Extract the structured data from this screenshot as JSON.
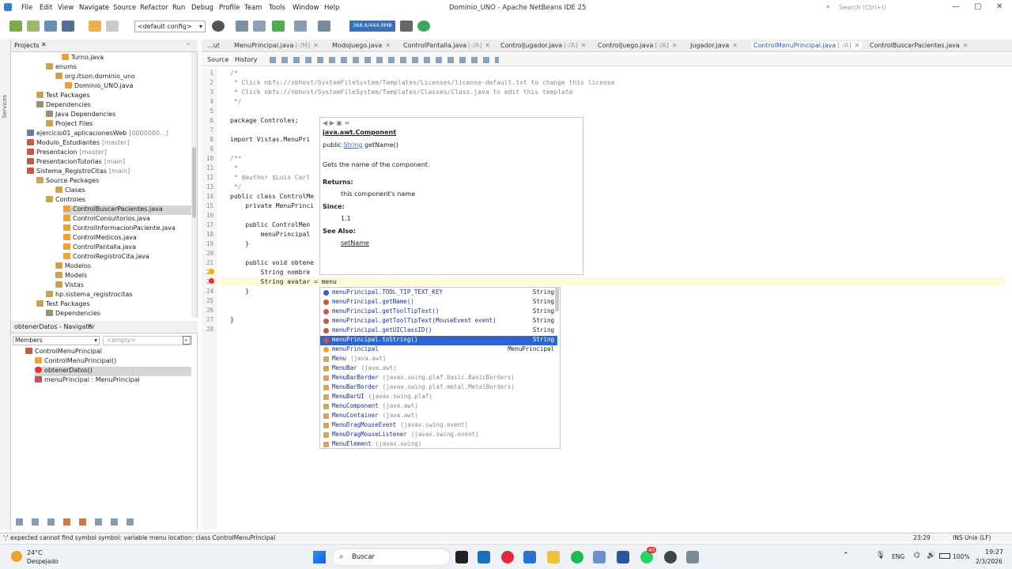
{
  "menubar": {
    "items": [
      "File",
      "Edit",
      "View",
      "Navigate",
      "Source",
      "Refactor",
      "Run",
      "Debug",
      "Profile",
      "Team",
      "Tools",
      "Window",
      "Help"
    ],
    "title": "Dominio_UNO - Apache NetBeans IDE 25",
    "search_placeholder": "Search (Ctrl+I)"
  },
  "toolbar": {
    "config": "<default config>",
    "memory": "368.6/444.0MB"
  },
  "projects": {
    "tab": "Projects",
    "items": [
      {
        "label": "Turno.java",
        "tag": ""
      },
      {
        "label": "enums",
        "tag": ""
      },
      {
        "label": "org.itson.dominio_uno",
        "tag": ""
      },
      {
        "label": "Dominio_UNO.java",
        "tag": ""
      },
      {
        "label": "Test Packages",
        "tag": ""
      },
      {
        "label": "Dependencies",
        "tag": ""
      },
      {
        "label": "Java Dependencies",
        "tag": ""
      },
      {
        "label": "Project Files",
        "tag": ""
      },
      {
        "label": "ejercicio01_aplicacionesWeb",
        "tag": "[0000000...]"
      },
      {
        "label": "Modulo_Estudiantes",
        "tag": "[master]"
      },
      {
        "label": "Presentacion",
        "tag": "[master]"
      },
      {
        "label": "PresentacionTutorias",
        "tag": "[main]"
      },
      {
        "label": "Sistema_RegistroCitas",
        "tag": "[main]"
      },
      {
        "label": "Source Packages",
        "tag": ""
      },
      {
        "label": "Clases",
        "tag": ""
      },
      {
        "label": "Controles",
        "tag": ""
      },
      {
        "label": "ControlBuscarPacientes.java",
        "tag": ""
      },
      {
        "label": "ControlConsultorios.java",
        "tag": ""
      },
      {
        "label": "ControlInformacionPaciente.java",
        "tag": ""
      },
      {
        "label": "ControlMedicos.java",
        "tag": ""
      },
      {
        "label": "ControlPantalla.java",
        "tag": ""
      },
      {
        "label": "ControlRegistroCita.java",
        "tag": ""
      },
      {
        "label": "Modelos",
        "tag": ""
      },
      {
        "label": "Models",
        "tag": ""
      },
      {
        "label": "Vistas",
        "tag": ""
      },
      {
        "label": "hp.sistema_registrocitas",
        "tag": ""
      },
      {
        "label": "Test Packages",
        "tag": ""
      },
      {
        "label": "Dependencies",
        "tag": ""
      }
    ]
  },
  "navigator": {
    "tab": "obtenerDatos - Navigator",
    "filter": "Members",
    "empty": "<empty>",
    "items": [
      "ControlMenuPrincipal",
      "ControlMenuPrincipal()",
      "obtenerDatos()",
      "menuPrincipal : MenuPrincipal"
    ]
  },
  "editor": {
    "tabs": [
      "...ut",
      "MenuPrincipal.java",
      "ModoJuego.java",
      "ControlPantalla.java",
      "ControlJugador.java",
      "ControlJuego.java",
      "Jugador.java",
      "ControlMenuPrincipal.java",
      "ControlBuscarPacientes.java"
    ],
    "tab_tags": [
      "",
      "[-/M]",
      "",
      "[-/A]",
      "[-/A]",
      "[-/A]",
      "",
      "[-/A]",
      ""
    ],
    "source_tab": "Source",
    "history_tab": "History",
    "lines": [
      "/*",
      " * Click nbfs://nbhost/SystemFileSystem/Templates/Licenses/license-default.txt to change this license",
      " * Click nbfs://nbhost/SystemFileSystem/Templates/Classes/Class.java to edit this template",
      " */",
      "",
      "package Controles;",
      "",
      "import Vistas.MenuPri",
      "",
      "/**",
      " *",
      " * @author $Luis Carl",
      " */",
      "public class ControlMe",
      "    private MenuPrinci",
      "",
      "    public ControlMen",
      "        menuPrincipal",
      "    }",
      "",
      "    public void obtene",
      "        String nombre",
      "        String avatar = menu",
      "    }",
      "",
      "",
      "}",
      ""
    ]
  },
  "doc": {
    "class": "java.awt.Component",
    "signature_pre": "public ",
    "signature_type": "String",
    "signature_post": " getName()",
    "desc": "Gets the name of the component.",
    "returns_h": "Returns:",
    "returns": "this component's name",
    "since_h": "Since:",
    "since": "1.1",
    "see_h": "See Also:",
    "see": "setName"
  },
  "completion": [
    {
      "name": "menuPrincipal.TOOL_TIP_TEXT_KEY",
      "pkg": "",
      "type": "String"
    },
    {
      "name": "menuPrincipal.getName()",
      "pkg": "",
      "type": "String"
    },
    {
      "name": "menuPrincipal.getToolTipText()",
      "pkg": "",
      "type": "String"
    },
    {
      "name": "menuPrincipal.getToolTipText(MouseEvent event)",
      "pkg": "",
      "type": "String"
    },
    {
      "name": "menuPrincipal.getUIClassID()",
      "pkg": "",
      "type": "String"
    },
    {
      "name": "menuPrincipal.toString()",
      "pkg": "",
      "type": "String"
    },
    {
      "name": "menuPrincipal",
      "pkg": "",
      "type": "MenuPrincipal"
    },
    {
      "name": "Menu",
      "pkg": "(java.awt)",
      "type": ""
    },
    {
      "name": "MenuBar",
      "pkg": "(java.awt)",
      "type": ""
    },
    {
      "name": "MenuBarBorder",
      "pkg": "(javax.swing.plaf.basic.BasicBorders)",
      "type": ""
    },
    {
      "name": "MenuBarBorder",
      "pkg": "(javax.swing.plaf.metal.MetalBorders)",
      "type": ""
    },
    {
      "name": "MenuBarUI",
      "pkg": "(javax.swing.plaf)",
      "type": ""
    },
    {
      "name": "MenuComponent",
      "pkg": "(java.awt)",
      "type": ""
    },
    {
      "name": "MenuContainer",
      "pkg": "(java.awt)",
      "type": ""
    },
    {
      "name": "MenuDragMouseEvent",
      "pkg": "(javax.swing.event)",
      "type": ""
    },
    {
      "name": "MenuDragMouseListener",
      "pkg": "(javax.swing.event)",
      "type": ""
    },
    {
      "name": "MenuElement",
      "pkg": "(javax.swing)",
      "type": ""
    }
  ],
  "status": {
    "error": "';' expected  cannot find symbol  symbol:  variable menu  location: class ControlMenuPrincipal",
    "pos": "23:29",
    "mode": "INS Unix (LF)"
  },
  "taskbar": {
    "temp": "24°C",
    "weather": "Despejado",
    "search": "Buscar",
    "lang": "ENG",
    "battery": "100%",
    "time": "19:27",
    "date": "2/3/2026",
    "badge": "40"
  }
}
